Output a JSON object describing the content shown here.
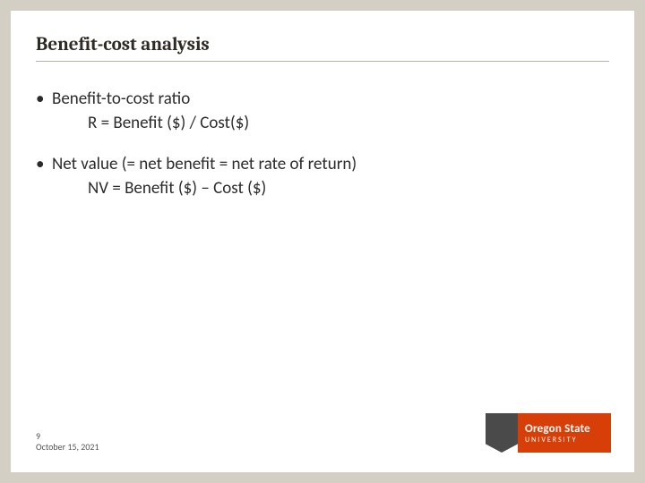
{
  "slide": {
    "title": "Benefit-cost analysis",
    "bullets": [
      {
        "text": "Benefit-to-cost ratio",
        "sub": "R = Benefit ($) / Cost($)"
      },
      {
        "text": "Net value (= net benefit = net rate of return)",
        "sub": "NV = Benefit ($) – Cost ($)"
      }
    ],
    "footer": {
      "page": "9",
      "date": "October 15, 2021"
    },
    "logo": {
      "line1": "Oregon State",
      "line2": "UNIVERSITY"
    }
  }
}
